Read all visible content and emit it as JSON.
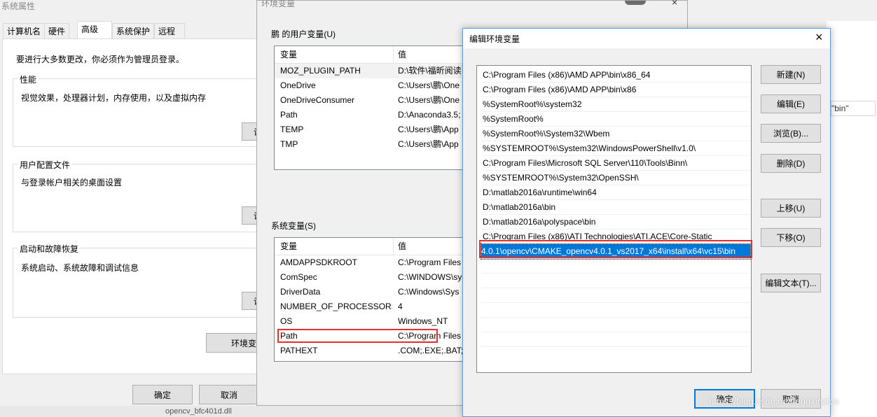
{
  "sysprops": {
    "title": "系统属性",
    "tabs": [
      "计算机名",
      "硬件",
      "高级",
      "系统保护",
      "远程"
    ],
    "active_tab": 2,
    "admin_note": "要进行大多数更改，你必须作为管理员登录。",
    "groups": [
      {
        "title": "性能",
        "desc": "视觉效果，处理器计划，内存使用，以及虚拟内存",
        "btn": "设"
      },
      {
        "title": "用户配置文件",
        "desc": "与登录帐户相关的桌面设置",
        "btn": "设"
      },
      {
        "title": "启动和故障恢复",
        "desc": "系统启动、系统故障和调试信息",
        "btn": "设"
      }
    ],
    "env_button": "环境变",
    "ok": "确定",
    "cancel": "取消"
  },
  "envvars": {
    "title": "环境变量",
    "user_group": "鹏 的用户变量(U)",
    "sys_group": "系统变量(S)",
    "col_var": "变量",
    "col_val": "值",
    "user_rows": [
      {
        "name": "MOZ_PLUGIN_PATH",
        "value": "D:\\软件\\福昕阅读"
      },
      {
        "name": "OneDrive",
        "value": "C:\\Users\\鹏\\One"
      },
      {
        "name": "OneDriveConsumer",
        "value": "C:\\Users\\鹏\\One"
      },
      {
        "name": "Path",
        "value": "D:\\Anaconda3.5;"
      },
      {
        "name": "TEMP",
        "value": "C:\\Users\\鹏\\App"
      },
      {
        "name": "TMP",
        "value": "C:\\Users\\鹏\\App"
      }
    ],
    "sys_rows": [
      {
        "name": "AMDAPPSDKROOT",
        "value": "C:\\Program Files"
      },
      {
        "name": "ComSpec",
        "value": "C:\\WINDOWS\\sy"
      },
      {
        "name": "DriverData",
        "value": "C:\\Windows\\Sys"
      },
      {
        "name": "NUMBER_OF_PROCESSORS",
        "value": "4"
      },
      {
        "name": "OS",
        "value": "Windows_NT"
      },
      {
        "name": "Path",
        "value": "C:\\Program Files"
      },
      {
        "name": "PATHEXT",
        "value": ".COM;.EXE;.BAT;"
      }
    ]
  },
  "editenv": {
    "title": "编辑环境变量",
    "close": "×",
    "entries": [
      "C:\\Program Files (x86)\\AMD APP\\bin\\x86_64",
      "C:\\Program Files (x86)\\AMD APP\\bin\\x86",
      "%SystemRoot%\\system32",
      "%SystemRoot%",
      "%SystemRoot%\\System32\\Wbem",
      "%SYSTEMROOT%\\System32\\WindowsPowerShell\\v1.0\\",
      "C:\\Program Files\\Microsoft SQL Server\\110\\Tools\\Binn\\",
      "%SYSTEMROOT%\\System32\\OpenSSH\\",
      "D:\\matlab2016a\\runtime\\win64",
      "D:\\matlab2016a\\bin",
      "D:\\matlab2016a\\polyspace\\bin",
      "C:\\Program Files (x86)\\ATI Technologies\\ATI.ACE\\Core-Static",
      "4.0.1\\opencv\\CMAKE_opencv4.0.1_vs2017_x64\\install\\x64\\vc15\\bin"
    ],
    "selected_index": 12,
    "buttons": {
      "new": "新建(N)",
      "edit": "编辑(E)",
      "browse": "浏览(B)...",
      "delete": "删除(D)",
      "up": "上移(U)",
      "down": "下移(O)",
      "edit_text": "编辑文本(T)..."
    },
    "ok": "确定",
    "cancel": "取消"
  },
  "background": {
    "search_text": "\"bin\"",
    "watermark": "https://blog.csdn.net/fengxinzioo",
    "file_item": "opencv_bfc401d.dll"
  },
  "colors": {
    "selection": "#0078d7",
    "highlight_box": "#e0302f",
    "dialog_bg": "#f0f0f0"
  }
}
